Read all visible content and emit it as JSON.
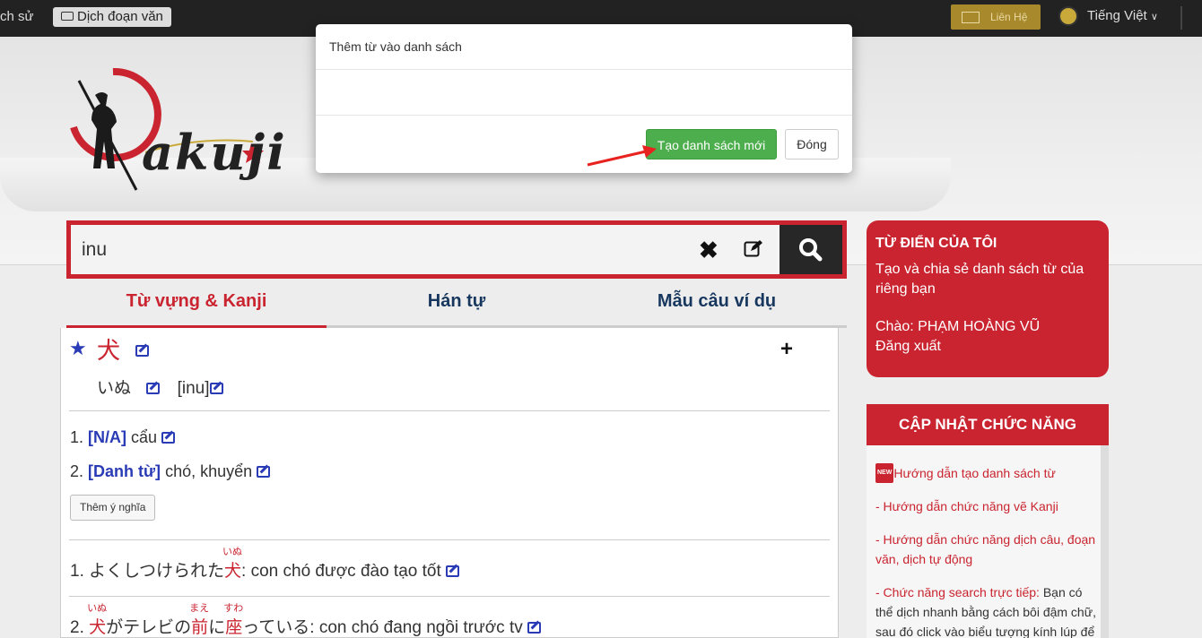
{
  "topbar": {
    "history_label": "ch sử",
    "translate_label": "Dịch đoạn văn",
    "contact_label": "Liên Hệ",
    "language_label": "Tiếng Việt"
  },
  "logo": {
    "text": "akuji"
  },
  "search": {
    "value": "inu"
  },
  "tabs": [
    {
      "label": "Từ vựng & Kanji"
    },
    {
      "label": "Hán tự"
    },
    {
      "label": "Mẫu câu ví dụ"
    }
  ],
  "entry": {
    "word": "犬",
    "kana": "いぬ",
    "romaji": "[inu]",
    "meanings": [
      {
        "num": "1.",
        "pos": "[N/A]",
        "text": "cẩu"
      },
      {
        "num": "2.",
        "pos": "[Danh từ]",
        "text": "chó, khuyển"
      }
    ],
    "add_meaning_label": "Thêm ý nghĩa",
    "examples": [
      {
        "num": "1.",
        "pre": "よくしつけられた",
        "w1": "犬",
        "w1_ruby": "いぬ",
        "rest": ": con chó được đào tạo tốt"
      },
      {
        "num": "2.",
        "w1": "犬",
        "w1_ruby": "いぬ",
        "mid1": "がテレビの",
        "w2": "前",
        "w2_ruby": "まえ",
        "mid2": "に",
        "w3": "座",
        "w3_ruby": "すわ",
        "rest": "っている: con chó đang ngồi trước tv"
      }
    ]
  },
  "sidebar": {
    "my_dict": {
      "title": "TỪ ĐIỂN CỦA TÔI",
      "desc": "Tạo và chia sẻ danh sách từ của riêng bạn",
      "greeting": "Chào: PHẠM HOÀNG VŨ",
      "logout": "Đăng xuất"
    },
    "updates": {
      "title": "CẬP NHẬT CHỨC NĂNG",
      "new_badge": "NEW",
      "items": [
        "Hướng dẫn tạo danh sách từ",
        "- Hướng dẫn chức năng vẽ Kanji",
        "- Hướng dẫn chức năng dịch câu, đoạn văn, dịch tự động"
      ],
      "search_item_link": "- Chức năng search trực tiếp:",
      "search_item_text": " Bạn có thể dịch nhanh bằng cách bôi đậm chữ, sau đó click vào biểu tượng kính lúp để"
    }
  },
  "modal": {
    "title": "Thêm từ vào danh sách",
    "create_label": "Tạo danh sách mới",
    "close_label": "Đóng"
  },
  "colors": {
    "brand_red": "#c9242f",
    "link_blue": "#2a3bb6",
    "success_green": "#4cae4c"
  }
}
